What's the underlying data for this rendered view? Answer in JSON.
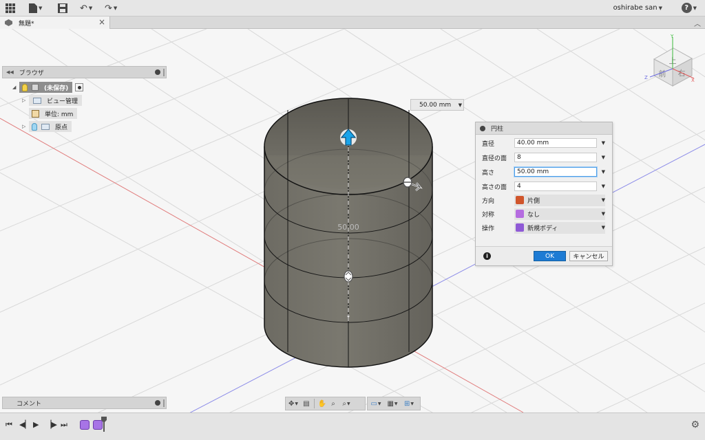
{
  "toolbar": {
    "items": [
      "grid-menu",
      "file-menu",
      "save",
      "undo",
      "redo"
    ],
    "user_name": "oshirabe san",
    "help_label": "?"
  },
  "tab": {
    "title": "無題*",
    "close": "×",
    "collapse": "^"
  },
  "browser": {
    "title": "ブラウザ",
    "root_label": "(未保存)",
    "items": [
      {
        "label": "ビュー管理"
      },
      {
        "label": "単位: mm"
      },
      {
        "label": "原点"
      }
    ]
  },
  "canvas": {
    "dimension_input": "50.00 mm",
    "dimension_label": "50.00",
    "viewcube": {
      "top": "上",
      "front": "前",
      "right": "右"
    },
    "axes": {
      "x": "X",
      "y": "Y",
      "z": "Z"
    }
  },
  "dialog": {
    "title": "円柱",
    "fields": [
      {
        "label": "直径",
        "value": "40.00 mm"
      },
      {
        "label": "直径の面",
        "value": "8"
      },
      {
        "label": "高さ",
        "value": "50.00 mm"
      },
      {
        "label": "高さの面",
        "value": "4"
      }
    ],
    "selects": [
      {
        "label": "方向",
        "value": "片側",
        "color": "#d0552b"
      },
      {
        "label": "対称",
        "value": "なし",
        "color": "#b56ce0"
      },
      {
        "label": "操作",
        "value": "新規ボディ",
        "color": "#8f5ad6"
      }
    ],
    "info": "i",
    "ok": "OK",
    "cancel": "キャンセル"
  },
  "comments": {
    "title": "コメント"
  },
  "colors": {
    "accent": "#1d7bd4",
    "cylinder": "#6e6c64",
    "feature": "#a774e6"
  }
}
